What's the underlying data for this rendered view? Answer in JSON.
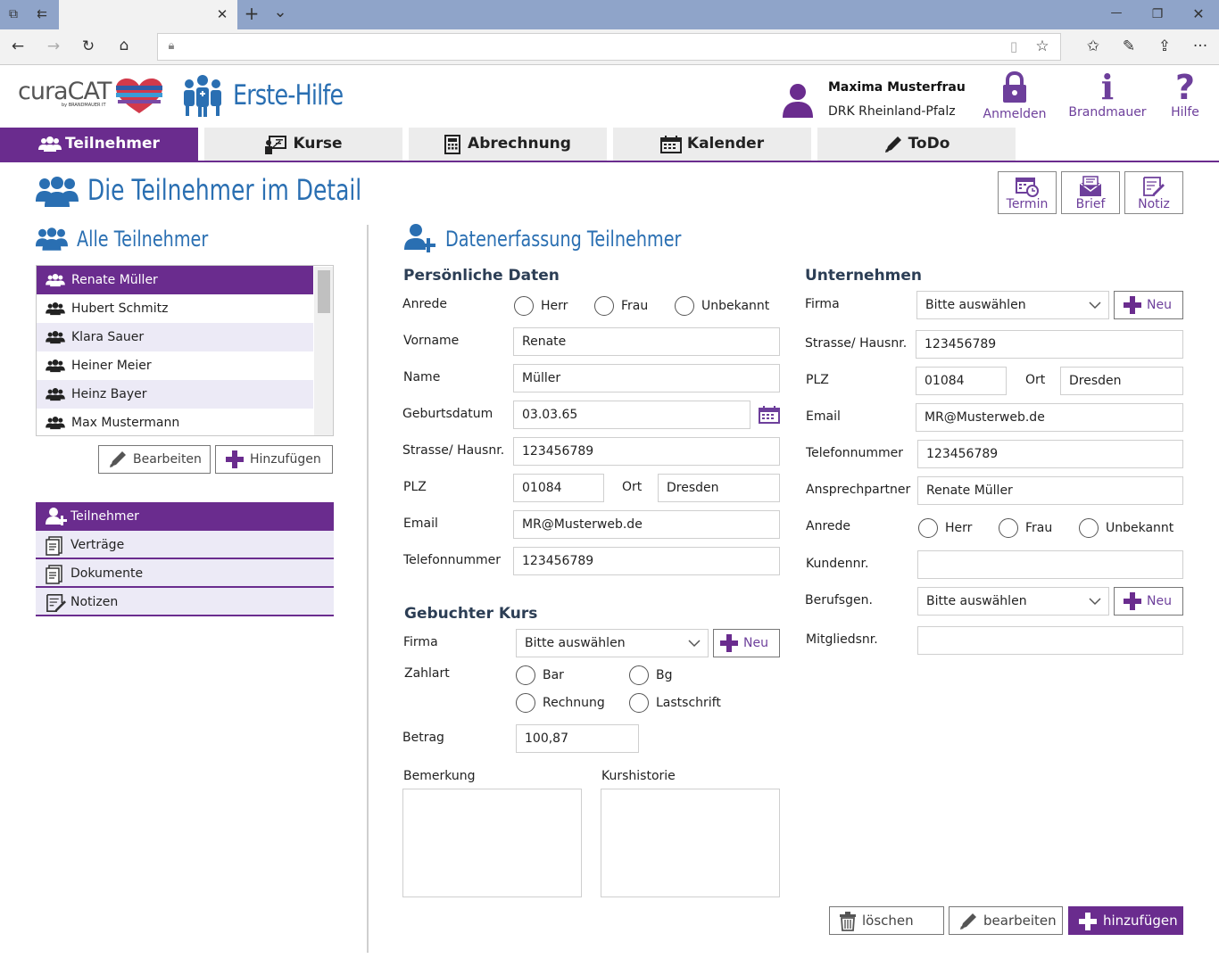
{
  "browser": {
    "tab_close": "✕",
    "new_tab": "+",
    "tab_menu": "⌄",
    "url": "",
    "window_minimize": "—",
    "window_restore": "❐",
    "window_close": "✕",
    "more": "···"
  },
  "header": {
    "logo_text": "curaCAT",
    "logo_subtext": "by BRANDMAUER IT",
    "app_title": "Erste-Hilfe",
    "user_name": "Maxima Musterfrau",
    "user_org": "DRK Rheinland-Pfalz",
    "buttons": [
      {
        "label": "Anmelden",
        "icon": "lock-icon"
      },
      {
        "label": "Brandmauer",
        "icon": "info-icon"
      },
      {
        "label": "Hilfe",
        "icon": "question-icon"
      }
    ],
    "info_glyph": "i",
    "help_glyph": "?"
  },
  "nav": {
    "tabs": [
      {
        "label": "Teilnehmer",
        "icon": "users-icon",
        "active": true
      },
      {
        "label": "Kurse",
        "icon": "board-icon",
        "active": false
      },
      {
        "label": "Abrechnung",
        "icon": "calculator-icon",
        "active": false
      },
      {
        "label": "Kalender",
        "icon": "calendar-icon",
        "active": false
      },
      {
        "label": "ToDo",
        "icon": "pencil-icon",
        "active": false
      }
    ]
  },
  "page": {
    "title": "Die Teilnehmer im Detail",
    "toolbar": [
      {
        "label": "Termin",
        "icon": "calendar-clock-icon"
      },
      {
        "label": "Brief",
        "icon": "envelope-icon"
      },
      {
        "label": "Notiz",
        "icon": "note-icon"
      }
    ]
  },
  "left": {
    "title": "Alle Teilnehmer",
    "participants": [
      "Renate Müller",
      "Hubert Schmitz",
      "Klara Sauer",
      "Heiner Meier",
      "Heinz Bayer",
      "Max Mustermann"
    ],
    "selected_index": 0,
    "edit_label": "Bearbeiten",
    "add_label": "Hinzufügen",
    "menu": [
      {
        "label": "Teilnehmer",
        "icon": "user-add-icon",
        "active": true
      },
      {
        "label": "Verträge",
        "icon": "document-icon",
        "active": false
      },
      {
        "label": "Dokumente",
        "icon": "documents-icon",
        "active": false
      },
      {
        "label": "Notizen",
        "icon": "note-icon",
        "active": false
      }
    ]
  },
  "form": {
    "title": "Datenerfassung Teilnehmer",
    "personal": {
      "heading": "Persönliche Daten",
      "anrede_label": "Anrede",
      "anrede_options": [
        "Herr",
        "Frau",
        "Unbekannt"
      ],
      "vorname_label": "Vorname",
      "vorname": "Renate",
      "name_label": "Name",
      "name": "Müller",
      "geburtsdatum_label": "Geburtsdatum",
      "geburtsdatum": "03.03.65",
      "strasse_label": "Strasse/ Hausnr.",
      "strasse": "123456789",
      "plz_label": "PLZ",
      "plz": "01084",
      "ort_label": "Ort",
      "ort": "Dresden",
      "email_label": "Email",
      "email": "MR@Musterweb.de",
      "telefon_label": "Telefonnummer",
      "telefon": "123456789"
    },
    "kurs": {
      "heading": "Gebuchter Kurs",
      "firma_label": "Firma",
      "firma": "Bitte auswählen",
      "neu_label": "Neu",
      "zahlart_label": "Zahlart",
      "zahlart_options": [
        "Bar",
        "Bg",
        "Rechnung",
        "Lastschrift"
      ],
      "betrag_label": "Betrag",
      "betrag": "100,87",
      "bemerkung_label": "Bemerkung",
      "kurshistorie_label": "Kurshistorie"
    },
    "company": {
      "heading": "Unternehmen",
      "firma_label": "Firma",
      "firma": "Bitte auswählen",
      "neu_label": "Neu",
      "strasse_label": "Strasse/ Hausnr.",
      "strasse": "123456789",
      "plz_label": "PLZ",
      "plz": "01084",
      "ort_label": "Ort",
      "ort": "Dresden",
      "email_label": "Email",
      "email": "MR@Musterweb.de",
      "telefon_label": "Telefonnummer",
      "telefon": "123456789",
      "ansprech_label": "Ansprechpartner",
      "ansprech": "Renate Müller",
      "anrede_label": "Anrede",
      "anrede_options": [
        "Herr",
        "Frau",
        "Unbekannt"
      ],
      "kundennr_label": "Kundennr.",
      "kundennr": "",
      "berufsgen_label": "Berufsgen.",
      "berufsgen": "Bitte auswählen",
      "neu2_label": "Neu",
      "mitglied_label": "Mitgliedsnr.",
      "mitglied": ""
    },
    "actions": {
      "delete": "löschen",
      "edit": "bearbeiten",
      "add": "hinzufügen"
    }
  },
  "colors": {
    "accent": "#6a2c8e",
    "blue": "#2a6fb2",
    "list_alt": "#eceaf6"
  }
}
